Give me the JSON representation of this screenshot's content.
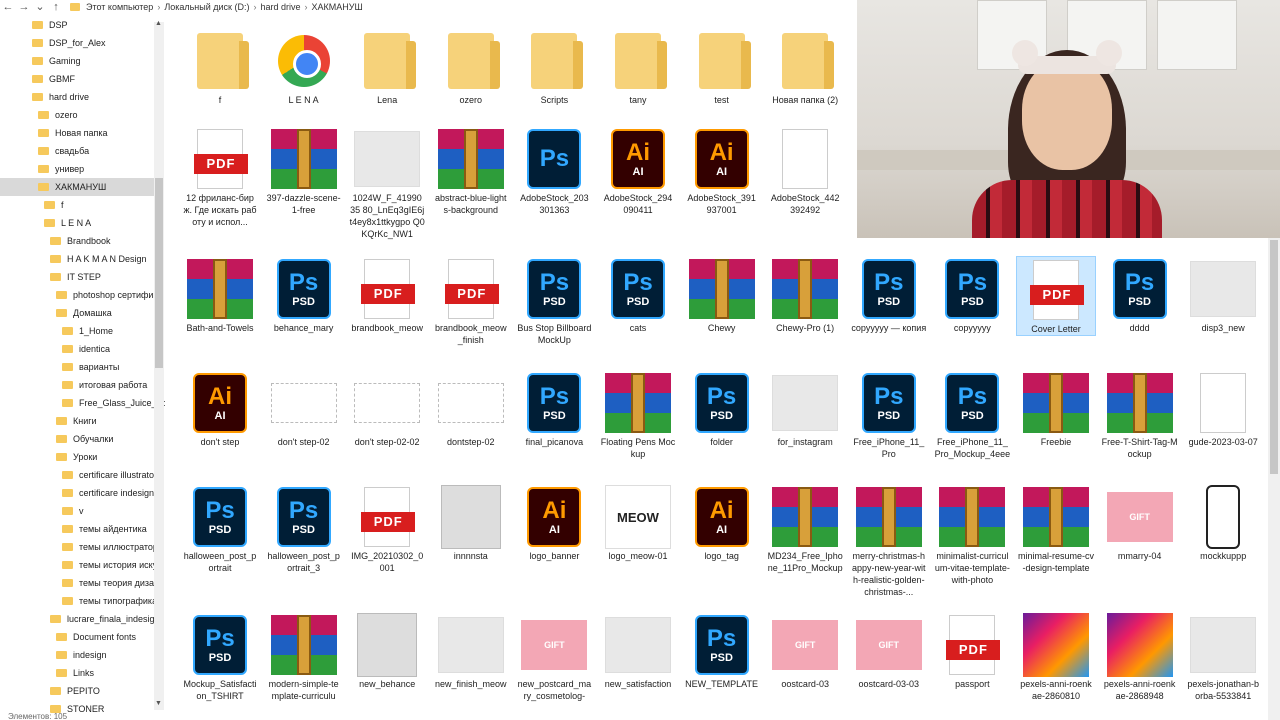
{
  "address_bar": {
    "back": "←",
    "forward": "→",
    "dropdown": "⌄",
    "up": "↑",
    "crumbs": [
      "Этот компьютер",
      "Локальный диск (D:)",
      "hard drive",
      "ХАКМАНУШ"
    ],
    "separator": "›"
  },
  "sidebar": {
    "items": [
      {
        "label": "DSP",
        "indent": 0
      },
      {
        "label": "DSP_for_Alex",
        "indent": 0
      },
      {
        "label": "Gaming",
        "indent": 0
      },
      {
        "label": "GBMF",
        "indent": 0
      },
      {
        "label": "hard drive",
        "indent": 0
      },
      {
        "label": "ozero",
        "indent": 1
      },
      {
        "label": "Новая папка",
        "indent": 1
      },
      {
        "label": "свадьба",
        "indent": 1
      },
      {
        "label": "универ",
        "indent": 1
      },
      {
        "label": "ХАКМАНУШ",
        "indent": 1,
        "selected": true
      },
      {
        "label": "f",
        "indent": 2
      },
      {
        "label": "L E N A",
        "indent": 2
      },
      {
        "label": "Brandbook",
        "indent": 3
      },
      {
        "label": "H A K M A N Design",
        "indent": 3
      },
      {
        "label": "IT STEP",
        "indent": 3
      },
      {
        "label": "photoshop сертифик",
        "indent": 4
      },
      {
        "label": "Домашка",
        "indent": 4
      },
      {
        "label": "1_Home",
        "indent": 5
      },
      {
        "label": "identica",
        "indent": 5
      },
      {
        "label": "варианты",
        "indent": 5
      },
      {
        "label": "итоговая работа",
        "indent": 5
      },
      {
        "label": "Free_Glass_Juice_Bot",
        "indent": 5
      },
      {
        "label": "Книги",
        "indent": 4
      },
      {
        "label": "Обучалки",
        "indent": 4
      },
      {
        "label": "Уроки",
        "indent": 4
      },
      {
        "label": "certificare illustrator",
        "indent": 5
      },
      {
        "label": "certificare indesign",
        "indent": 5
      },
      {
        "label": "v",
        "indent": 5
      },
      {
        "label": "темы айдентика",
        "indent": 5
      },
      {
        "label": "темы иллюстратор",
        "indent": 5
      },
      {
        "label": "темы история иску",
        "indent": 5
      },
      {
        "label": "темы теория дизай",
        "indent": 5
      },
      {
        "label": "темы типографика",
        "indent": 5
      },
      {
        "label": "lucrare_finala_indesign",
        "indent": 3
      },
      {
        "label": "Document fonts",
        "indent": 4
      },
      {
        "label": "indesign",
        "indent": 4
      },
      {
        "label": "Links",
        "indent": 4
      },
      {
        "label": "PEPITO",
        "indent": 3
      },
      {
        "label": "STONER",
        "indent": 3
      }
    ],
    "status": "Элементов: 105",
    "scroll_up": "▲",
    "scroll_down": "▼"
  },
  "files": {
    "rows": [
      [
        {
          "name": "f",
          "type": "folder-img"
        },
        {
          "name": "L E N A",
          "type": "chrome"
        },
        {
          "name": "Lena",
          "type": "folder-img"
        },
        {
          "name": "ozero",
          "type": "folder-img"
        },
        {
          "name": "Scripts",
          "type": "folder"
        },
        {
          "name": "tany",
          "type": "folder"
        },
        {
          "name": "test",
          "type": "folder-ai"
        },
        {
          "name": "Новая папка (2)",
          "type": "folder-ps"
        }
      ],
      [
        {
          "name": "12 фриланс-бирж. Где искать работу и испол...",
          "type": "pdf"
        },
        {
          "name": "397-dazzle-scene-1-free",
          "type": "rar"
        },
        {
          "name": "1024W_F_41990 35 80_LnEq3gIE6j t4ey8x1ttkygpo Q0KQrKc_NW1",
          "type": "img"
        },
        {
          "name": "abstract-blue-lights-background",
          "type": "rar"
        },
        {
          "name": "AdobeStock_203 301363",
          "type": "ps"
        },
        {
          "name": "AdobeStock_294 090411",
          "type": "ai"
        },
        {
          "name": "AdobeStock_391 937001",
          "type": "ai"
        },
        {
          "name": "AdobeStock_442 392492",
          "type": "doc"
        }
      ],
      [
        {
          "name": "Bath-and-Towels",
          "type": "rar"
        },
        {
          "name": "behance_mary",
          "type": "psd"
        },
        {
          "name": "brandbook_meow",
          "type": "pdf"
        },
        {
          "name": "brandbook_meow_finish",
          "type": "pdf"
        },
        {
          "name": "Bus Stop Billboard MockUp",
          "type": "psd"
        },
        {
          "name": "cats",
          "type": "psd"
        },
        {
          "name": "Chewy",
          "type": "rar"
        },
        {
          "name": "Chewy-Pro (1)",
          "type": "rar"
        },
        {
          "name": "copyyyyy — копия",
          "type": "psd"
        },
        {
          "name": "copyyyyy",
          "type": "psd"
        },
        {
          "name": "Cover Letter",
          "type": "pdf",
          "selected": true
        },
        {
          "name": "dddd",
          "type": "psd"
        },
        {
          "name": "disp3_new",
          "type": "img"
        }
      ],
      [
        {
          "name": "don't step",
          "type": "ai"
        },
        {
          "name": "don't step-02",
          "type": "sketch"
        },
        {
          "name": "don't step-02-02",
          "type": "sketch"
        },
        {
          "name": "dontstep-02",
          "type": "sketch"
        },
        {
          "name": "final_picanova",
          "type": "psd"
        },
        {
          "name": "Floating Pens Mockup",
          "type": "rar"
        },
        {
          "name": "folder",
          "type": "psd"
        },
        {
          "name": "for_instagram",
          "type": "img"
        },
        {
          "name": "Free_iPhone_11_Pro",
          "type": "psd"
        },
        {
          "name": "Free_iPhone_11_Pro_Mockup_4eee",
          "type": "psd"
        },
        {
          "name": "Freebie",
          "type": "rar"
        },
        {
          "name": "Free-T-Shirt-Tag-Mockup",
          "type": "rar"
        },
        {
          "name": "gude-2023-03-07",
          "type": "doc"
        }
      ],
      [
        {
          "name": "halloween_post_portrait",
          "type": "psd"
        },
        {
          "name": "halloween_post_portrait_3",
          "type": "psd"
        },
        {
          "name": "IMG_20210302_0001",
          "type": "pdf"
        },
        {
          "name": "innnnsta",
          "type": "photo"
        },
        {
          "name": "logo_banner",
          "type": "ai"
        },
        {
          "name": "logo_meow-01",
          "type": "meow"
        },
        {
          "name": "logo_tag",
          "type": "ai"
        },
        {
          "name": "MD234_Free_Iphone_11Pro_Mockup",
          "type": "rar"
        },
        {
          "name": "merry-christmas-happy-new-year-with-realistic-golden-christmas-...",
          "type": "rar"
        },
        {
          "name": "minimalist-curriculum-vitae-template-with-photo",
          "type": "rar"
        },
        {
          "name": "minimal-resume-cv-design-template",
          "type": "rar"
        },
        {
          "name": "mmarry-04",
          "type": "pink"
        },
        {
          "name": "mockkuppp",
          "type": "phone"
        }
      ],
      [
        {
          "name": "Mockup_Satisfaction_TSHIRT",
          "type": "psd"
        },
        {
          "name": "modern-simple-template-curriculu",
          "type": "rar"
        },
        {
          "name": "new_behance",
          "type": "photo"
        },
        {
          "name": "new_finish_meow",
          "type": "img"
        },
        {
          "name": "new_postcard_mary_cosmetolog-",
          "type": "pink"
        },
        {
          "name": "new_satisfaction",
          "type": "img"
        },
        {
          "name": "NEW_TEMPLATE",
          "type": "psd"
        },
        {
          "name": "oostcard-03",
          "type": "pink"
        },
        {
          "name": "oostcard-03-03",
          "type": "pink"
        },
        {
          "name": "passport",
          "type": "pdf"
        },
        {
          "name": "pexels-anni-roenkae-2860810",
          "type": "swirl"
        },
        {
          "name": "pexels-anni-roenkae-2868948",
          "type": "swirl"
        },
        {
          "name": "pexels-jonathan-borba-5533841",
          "type": "img"
        }
      ]
    ],
    "icon_text": {
      "pdf": "PDF",
      "ps": "Ps",
      "psd": "PSD",
      "ai": "Ai",
      "ai_sub": "AI",
      "meow": "MEOW",
      "gift": "GIFT"
    }
  },
  "colors": {
    "ps_bg": "#001e36",
    "ps_fg": "#31a8ff",
    "ai_bg": "#330000",
    "ai_fg": "#ff9a00",
    "pdf_red": "#d81e1e",
    "folder": "#f6d27a",
    "selection": "#cce8ff"
  }
}
